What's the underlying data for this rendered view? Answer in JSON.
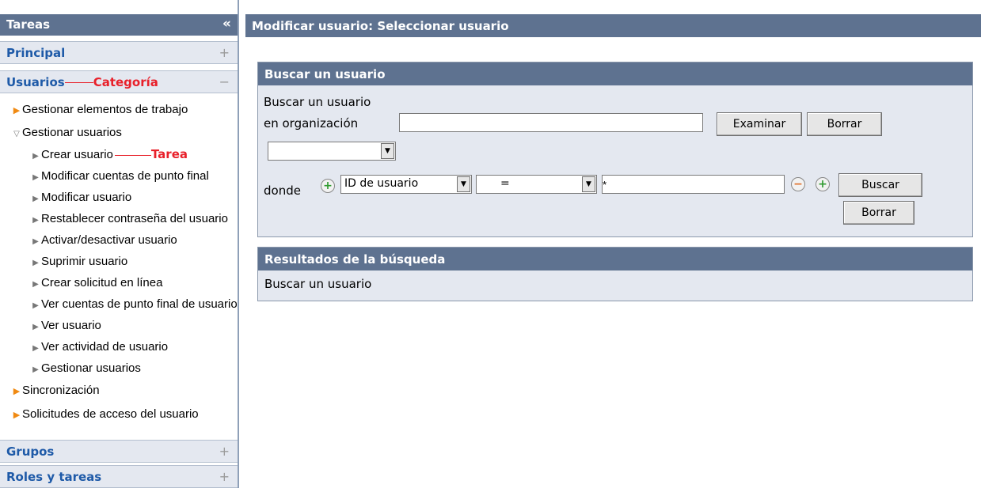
{
  "sidebar": {
    "title": "Tareas",
    "collapse_icon": "«",
    "categories": {
      "principal": "Principal",
      "usuarios": "Usuarios",
      "usuarios_annotation": "Categoría",
      "grupos": "Grupos",
      "roles": "Roles y tareas"
    },
    "expand_glyph": "+",
    "collapse_glyph": "−",
    "tasks": [
      "Gestionar elementos de trabajo",
      "Gestionar usuarios",
      "Crear usuario",
      "Modificar cuentas de punto final",
      "Modificar usuario",
      "Restablecer contraseña del usuario",
      "Activar/desactivar usuario",
      "Suprimir usuario",
      "Crear solicitud en línea",
      "Ver cuentas de punto final de usuario",
      "Ver usuario",
      "Ver actividad de usuario",
      "Gestionar usuarios",
      "Sincronización",
      "Solicitudes de acceso del usuario"
    ],
    "task_annotation": "Tarea"
  },
  "main": {
    "header": "Modificar usuario: Seleccionar usuario",
    "search_panel": {
      "title": "Buscar un usuario",
      "label_line1": "Buscar un usuario",
      "label_line2": "en organización",
      "org_value": "",
      "examine_button": "Examinar",
      "clear_button_top": "Borrar",
      "scope_select": "",
      "where_label": "donde",
      "attribute_select": "ID de usuario",
      "operator_select": "=",
      "value": "*",
      "search_button": "Buscar",
      "clear_button_bottom": "Borrar"
    },
    "results_panel": {
      "title": "Resultados de la búsqueda",
      "message": "Buscar un usuario"
    }
  },
  "colors": {
    "header_bg": "#5e7290",
    "panel_bg": "#e4e8f0",
    "category_text": "#1e5aa8",
    "annotation": "#e8202a",
    "bullet_orange": "#f08a12"
  }
}
